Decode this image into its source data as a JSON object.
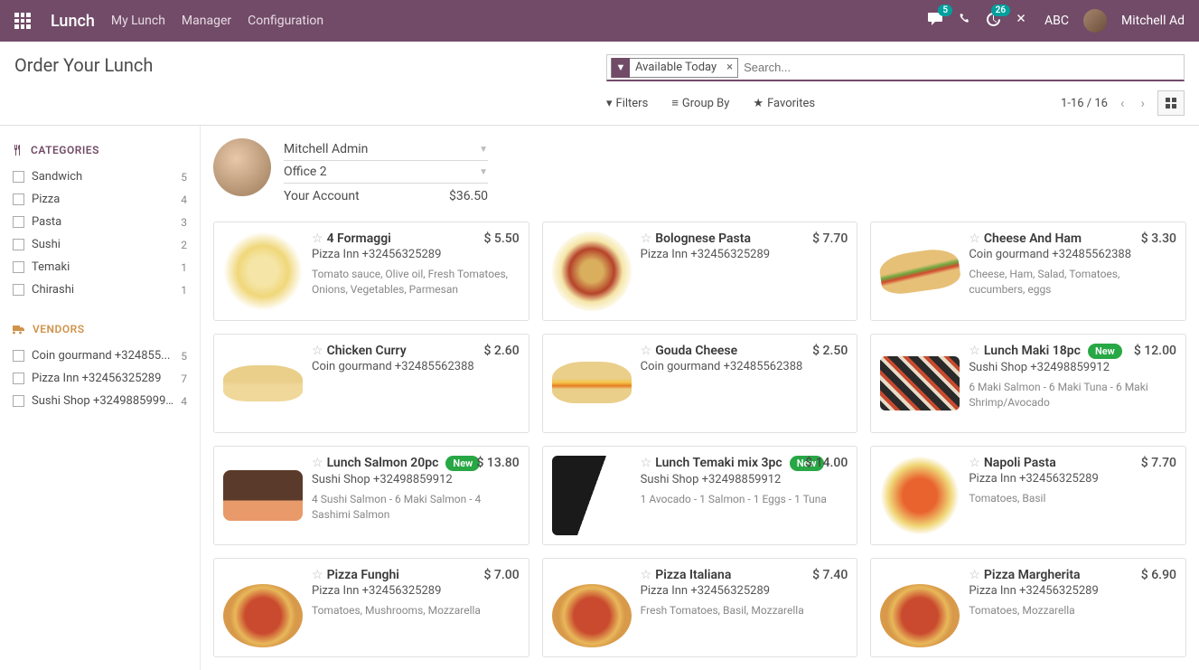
{
  "navbar": {
    "brand": "Lunch",
    "links": [
      "My Lunch",
      "Manager",
      "Configuration"
    ],
    "msg_badge": "5",
    "activity_badge": "26",
    "company": "ABC",
    "user": "Mitchell Ad"
  },
  "header": {
    "title": "Order Your Lunch",
    "search_facet": "Available Today",
    "search_placeholder": "Search...",
    "filters_label": "Filters",
    "groupby_label": "Group By",
    "favorites_label": "Favorites",
    "pager": "1-16 / 16"
  },
  "sidebar": {
    "categories_title": "CATEGORIES",
    "vendors_title": "VENDORS",
    "categories": [
      {
        "label": "Sandwich",
        "count": "5"
      },
      {
        "label": "Pizza",
        "count": "4"
      },
      {
        "label": "Pasta",
        "count": "3"
      },
      {
        "label": "Sushi",
        "count": "2"
      },
      {
        "label": "Temaki",
        "count": "1"
      },
      {
        "label": "Chirashi",
        "count": "1"
      }
    ],
    "vendors": [
      {
        "label": "Coin gourmand +324855...",
        "count": "5"
      },
      {
        "label": "Pizza Inn +32456325289",
        "count": "7"
      },
      {
        "label": "Sushi Shop +3249885999...",
        "count": "4"
      }
    ]
  },
  "user": {
    "name": "Mitchell Admin",
    "office": "Office 2",
    "account_label": "Your Account",
    "account_balance": "$36.50"
  },
  "products": [
    {
      "title": "4 Formaggi",
      "vendor": "Pizza Inn +32456325289",
      "desc": "Tomato sauce, Olive oil, Fresh Tomatoes, Onions, Vegetables, Parmesan",
      "price": "$ 5.50",
      "img": "food-pasta"
    },
    {
      "title": "Bolognese Pasta",
      "vendor": "Pizza Inn +32456325289",
      "desc": "",
      "price": "$ 7.70",
      "img": "food-bolognese"
    },
    {
      "title": "Cheese And Ham",
      "vendor": "Coin gourmand +32485562388",
      "desc": "Cheese, Ham, Salad, Tomatoes, cucumbers, eggs",
      "price": "$ 3.30",
      "img": "food-sandwich"
    },
    {
      "title": "Chicken Curry",
      "vendor": "Coin gourmand +32485562388",
      "desc": "",
      "price": "$ 2.60",
      "img": "food-curry-sandwich"
    },
    {
      "title": "Gouda Cheese",
      "vendor": "Coin gourmand +32485562388",
      "desc": "",
      "price": "$ 2.50",
      "img": "food-gouda"
    },
    {
      "title": "Lunch Maki 18pc",
      "vendor": "Sushi Shop +32498859912",
      "desc": "6 Maki Salmon - 6 Maki Tuna - 6 Maki Shrimp/Avocado",
      "price": "$ 12.00",
      "img": "food-sushi",
      "new": true
    },
    {
      "title": "Lunch Salmon 20pc",
      "vendor": "Sushi Shop +32498859912",
      "desc": "4 Sushi Salmon - 6 Maki Salmon - 4 Sashimi Salmon",
      "price": "$ 13.80",
      "img": "food-sashimi",
      "new": true
    },
    {
      "title": "Lunch Temaki mix 3pc",
      "vendor": "Sushi Shop +32498859912",
      "desc": "1 Avocado - 1 Salmon - 1 Eggs - 1 Tuna",
      "price": "$ 14.00",
      "img": "food-temaki",
      "new": true
    },
    {
      "title": "Napoli Pasta",
      "vendor": "Pizza Inn +32456325289",
      "desc": "Tomatoes, Basil",
      "price": "$ 7.70",
      "img": "food-napoli"
    },
    {
      "title": "Pizza Funghi",
      "vendor": "Pizza Inn +32456325289",
      "desc": "Tomatoes, Mushrooms, Mozzarella",
      "price": "$ 7.00",
      "img": "food-pizza"
    },
    {
      "title": "Pizza Italiana",
      "vendor": "Pizza Inn +32456325289",
      "desc": "Fresh Tomatoes, Basil, Mozzarella",
      "price": "$ 7.40",
      "img": "food-pizza"
    },
    {
      "title": "Pizza Margherita",
      "vendor": "Pizza Inn +32456325289",
      "desc": "Tomatoes, Mozzarella",
      "price": "$ 6.90",
      "img": "food-pizza"
    }
  ],
  "labels": {
    "new_badge": "New"
  }
}
